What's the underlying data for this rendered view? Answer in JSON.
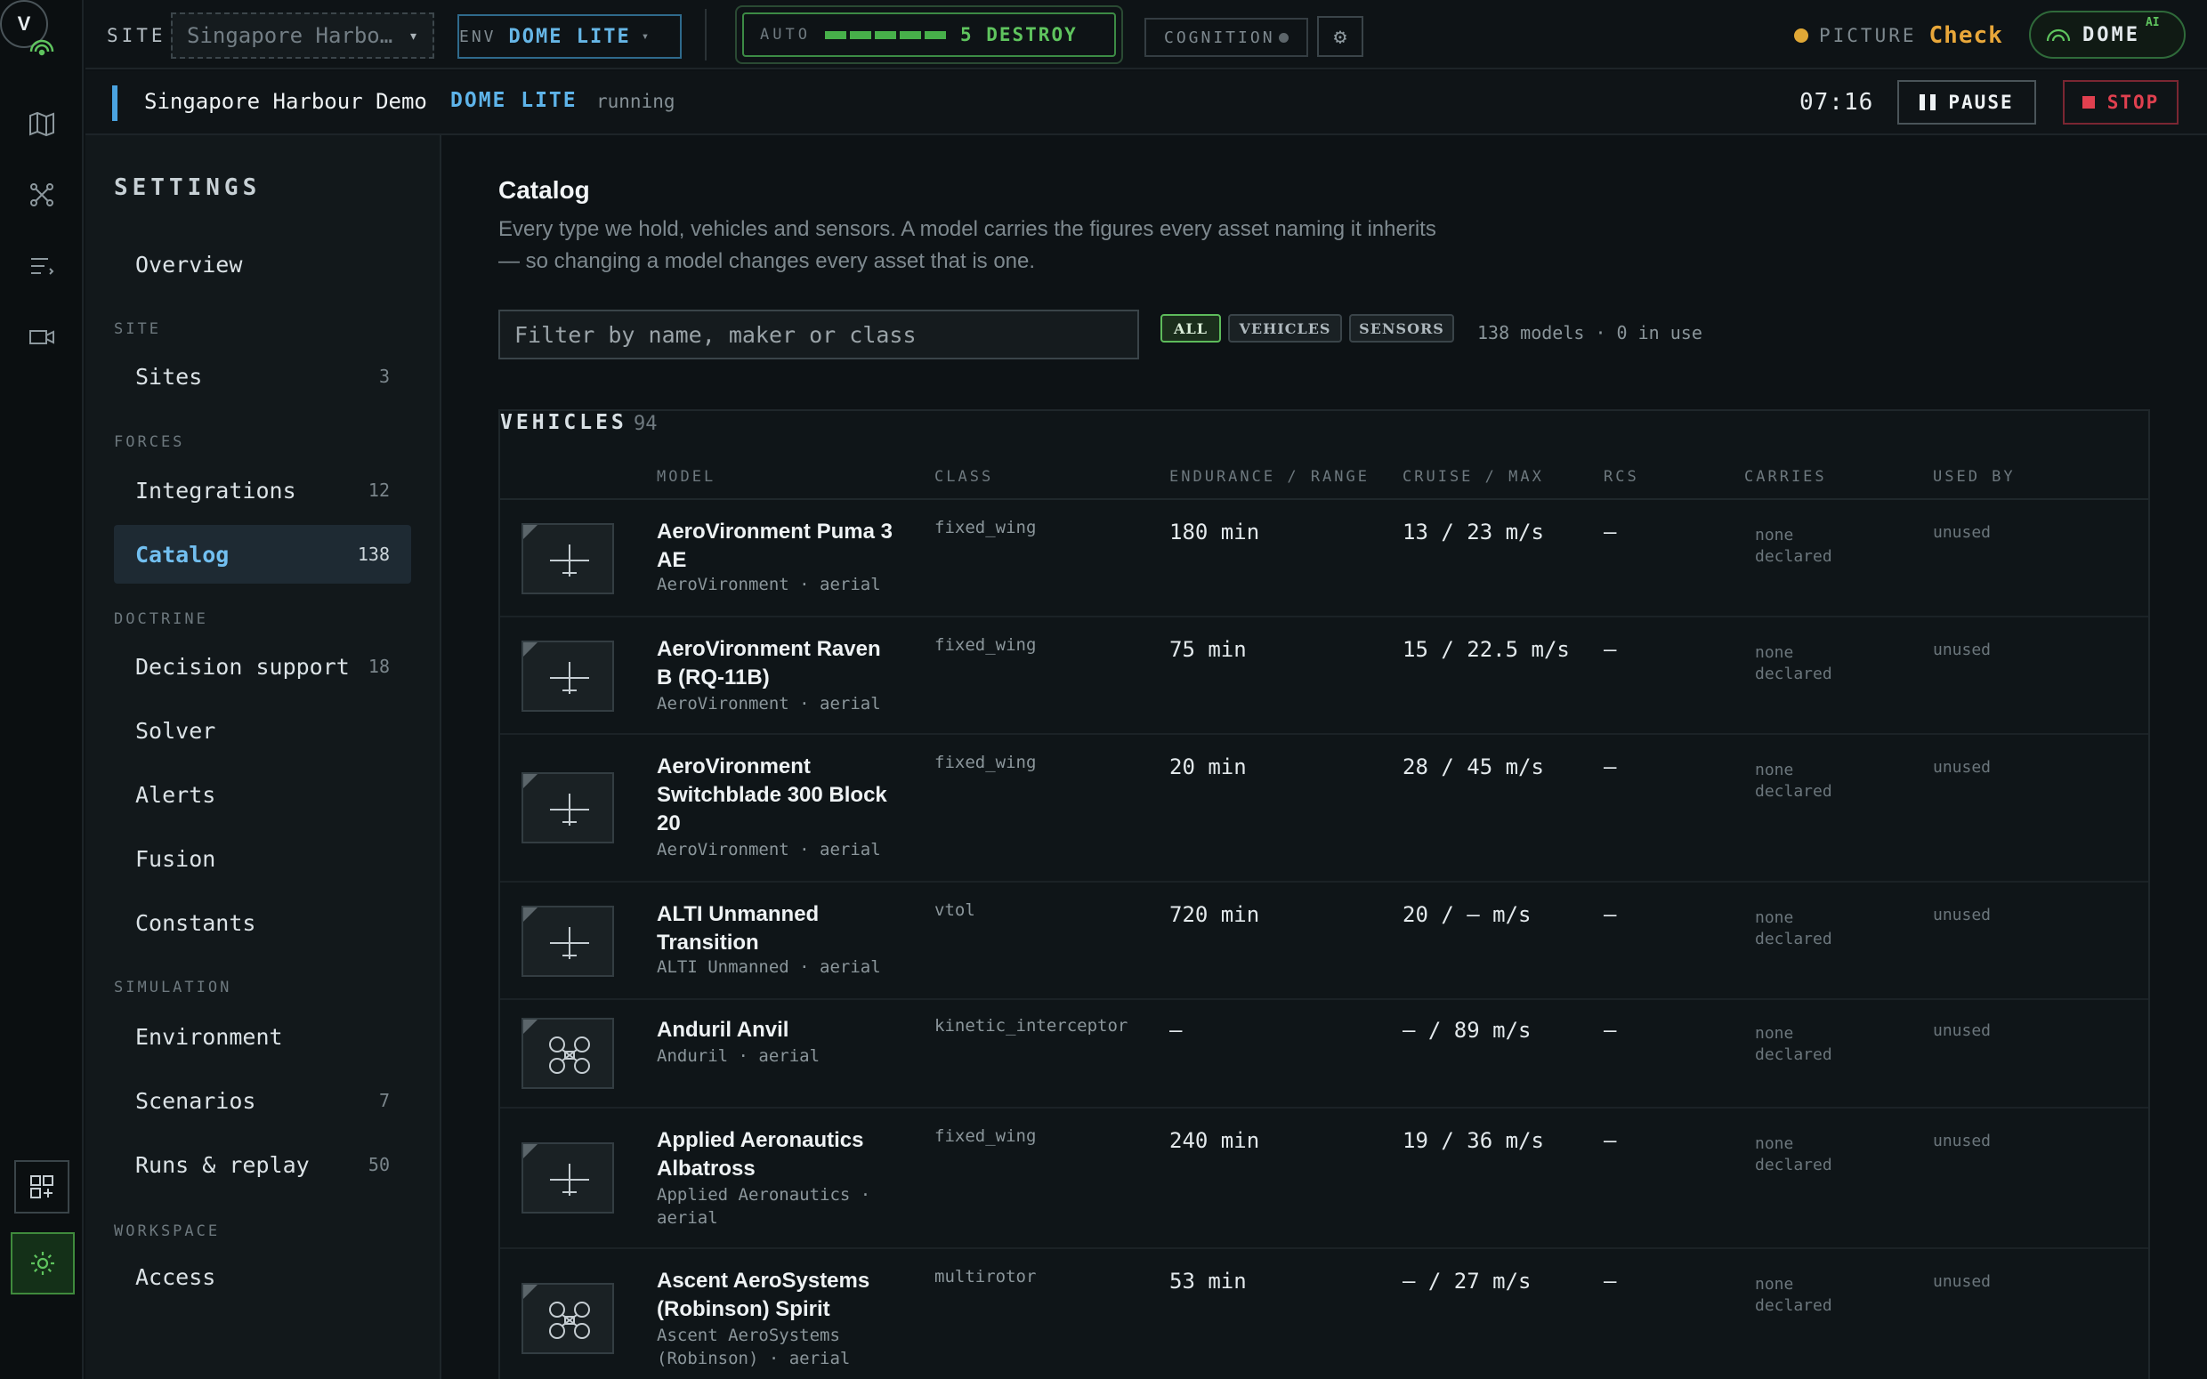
{
  "topbar": {
    "site_label": "SITE",
    "site_value": "Singapore Harbo…",
    "env_label": "ENV",
    "env_value": "DOME LITE",
    "auto_label": "AUTO",
    "auto_level": 5,
    "auto_value": "5 DESTROY",
    "cognition_label": "COGNITION",
    "picture_label": "PICTURE",
    "picture_value": "Check",
    "dome_label": "DOME",
    "dome_sup": "AI"
  },
  "runbar": {
    "name": "Singapore Harbour Demo",
    "env": "DOME LITE",
    "status": "running",
    "time": "07:16",
    "pause_label": "PAUSE",
    "stop_label": "STOP"
  },
  "rail": {
    "avatar": "V"
  },
  "settings": {
    "title": "SETTINGS",
    "overview": "Overview",
    "sections": {
      "site": "SITE",
      "forces": "FORCES",
      "doctrine": "DOCTRINE",
      "simulation": "SIMULATION",
      "workspace": "WORKSPACE"
    },
    "items": {
      "sites": {
        "label": "Sites",
        "count": "3"
      },
      "integrations": {
        "label": "Integrations",
        "count": "12"
      },
      "catalog": {
        "label": "Catalog",
        "count": "138"
      },
      "decision_support": {
        "label": "Decision support",
        "count": "18"
      },
      "solver": {
        "label": "Solver"
      },
      "alerts": {
        "label": "Alerts"
      },
      "fusion": {
        "label": "Fusion"
      },
      "constants": {
        "label": "Constants"
      },
      "environment": {
        "label": "Environment"
      },
      "scenarios": {
        "label": "Scenarios",
        "count": "7"
      },
      "runs_replay": {
        "label": "Runs & replay",
        "count": "50"
      },
      "access": {
        "label": "Access"
      }
    }
  },
  "catalog": {
    "title": "Catalog",
    "description": "Every type we hold, vehicles and sensors. A model carries the figures every asset naming it inherits — so changing a model changes every asset that is one.",
    "filter_placeholder": "Filter by name, maker or class",
    "filters": {
      "all": "ALL",
      "vehicles": "VEHICLES",
      "sensors": "SENSORS"
    },
    "count_text": "138 models · 0 in use",
    "table": {
      "title": "VEHICLES",
      "count": "94",
      "headers": {
        "model": "MODEL",
        "class": "CLASS",
        "endurance": "ENDURANCE / RANGE",
        "cruise": "CRUISE / MAX",
        "rcs": "RCS",
        "carries": "CARRIES",
        "used_by": "USED BY"
      },
      "rows": [
        {
          "name": "AeroVironment Puma 3 AE",
          "maker": "AeroVironment · aerial",
          "class": "fixed_wing",
          "endurance": "180 min",
          "cruise": "13 / 23 m/s",
          "rcs": "—",
          "carries": "none declared",
          "used_by": "unused",
          "icon": "fixed-wing-icon"
        },
        {
          "name": "AeroVironment Raven B (RQ-11B)",
          "maker": "AeroVironment · aerial",
          "class": "fixed_wing",
          "endurance": "75 min",
          "cruise": "15 / 22.5 m/s",
          "rcs": "—",
          "carries": "none declared",
          "used_by": "unused",
          "icon": "fixed-wing-icon"
        },
        {
          "name": "AeroVironment Switchblade 300 Block 20",
          "maker": "AeroVironment · aerial",
          "class": "fixed_wing",
          "endurance": "20 min",
          "cruise": "28 / 45 m/s",
          "rcs": "—",
          "carries": "none declared",
          "used_by": "unused",
          "icon": "fixed-wing-icon"
        },
        {
          "name": "ALTI Unmanned Transition",
          "maker": "ALTI Unmanned · aerial",
          "class": "vtol",
          "endurance": "720 min",
          "cruise": "20 / — m/s",
          "rcs": "—",
          "carries": "none declared",
          "used_by": "unused",
          "icon": "fixed-wing-icon"
        },
        {
          "name": "Anduril Anvil",
          "maker": "Anduril · aerial",
          "class": "kinetic_interceptor",
          "endurance": "—",
          "cruise": "— / 89 m/s",
          "rcs": "—",
          "carries": "none declared",
          "used_by": "unused",
          "icon": "multirotor-icon"
        },
        {
          "name": "Applied Aeronautics Albatross",
          "maker": "Applied Aeronautics · aerial",
          "class": "fixed_wing",
          "endurance": "240 min",
          "cruise": "19 / 36 m/s",
          "rcs": "—",
          "carries": "none declared",
          "used_by": "unused",
          "icon": "fixed-wing-icon"
        },
        {
          "name": "Ascent AeroSystems (Robinson) Spirit",
          "maker": "Ascent AeroSystems (Robinson) · aerial",
          "class": "multirotor",
          "endurance": "53 min",
          "cruise": "— / 27 m/s",
          "rcs": "—",
          "carries": "none declared",
          "used_by": "unused",
          "icon": "multirotor-icon"
        }
      ]
    }
  },
  "colors": {
    "accent_green": "#47b04a",
    "accent_blue": "#5eb4ea",
    "warning": "#e8a73a",
    "danger": "#e0404f"
  }
}
